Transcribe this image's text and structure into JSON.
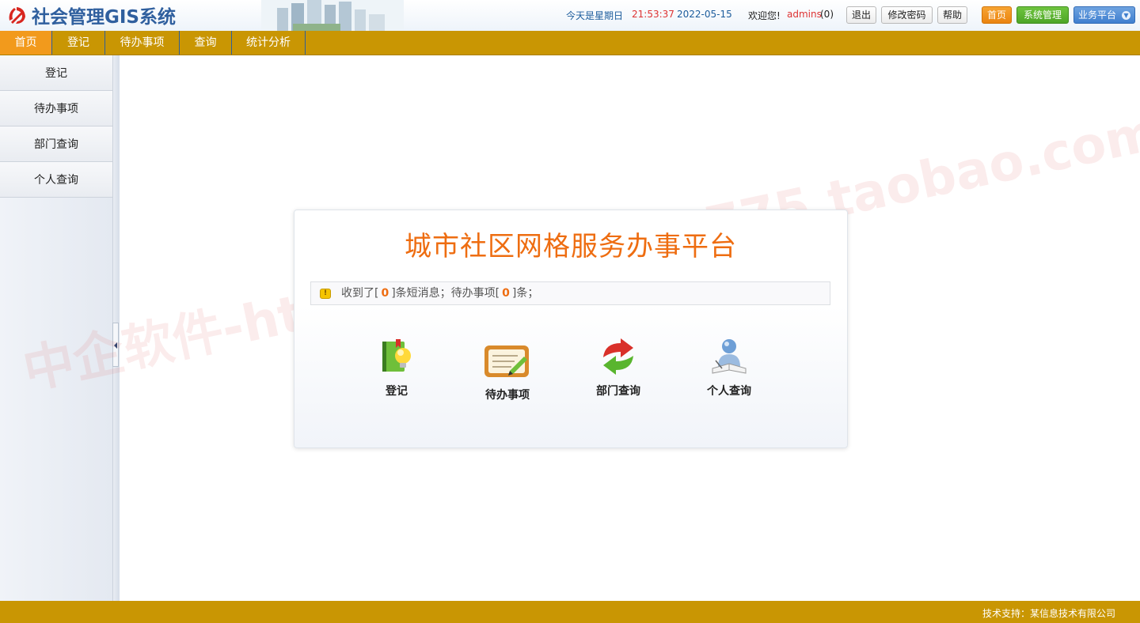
{
  "header": {
    "app_title": "社会管理GIS系统",
    "date_label": "今天是星期日",
    "time": "21:53:37",
    "date": "2022-05-15",
    "welcome": "欢迎您!",
    "username": "admins",
    "message_count": "(0)",
    "links": {
      "logout": "退出",
      "change_password": "修改密码",
      "help": "帮助"
    },
    "platform_buttons": {
      "home": "首页",
      "system": "系统管理",
      "business": "业务平台"
    },
    "colors": {
      "home": "#ea8410",
      "system": "#4ea626",
      "business": "#3f7fcf"
    }
  },
  "nav": {
    "tabs": [
      {
        "label": "首页",
        "active": true
      },
      {
        "label": "登记"
      },
      {
        "label": "待办事项"
      },
      {
        "label": "查询"
      },
      {
        "label": "统计分析"
      }
    ]
  },
  "sidebar": {
    "items": [
      {
        "label": "登记"
      },
      {
        "label": "待办事项"
      },
      {
        "label": "部门查询"
      },
      {
        "label": "个人查询"
      }
    ]
  },
  "main": {
    "title": "城市社区网格服务办事平台",
    "message": {
      "prefix": "收到了[",
      "sms_count": "0",
      "middle": "]条短消息；待办事项[",
      "todo_count": "0",
      "suffix": "]条；"
    },
    "quick_links": [
      {
        "label": "登记",
        "icon": "register-book-icon"
      },
      {
        "label": "待办事项",
        "icon": "todo-notepad-icon"
      },
      {
        "label": "部门查询",
        "icon": "dept-query-arrows-icon"
      },
      {
        "label": "个人查询",
        "icon": "person-query-icon"
      }
    ]
  },
  "watermark": "中企软件-https://shop1...2775.taobao.com",
  "footer": {
    "text": "技术支持：某信息技术有限公司"
  }
}
